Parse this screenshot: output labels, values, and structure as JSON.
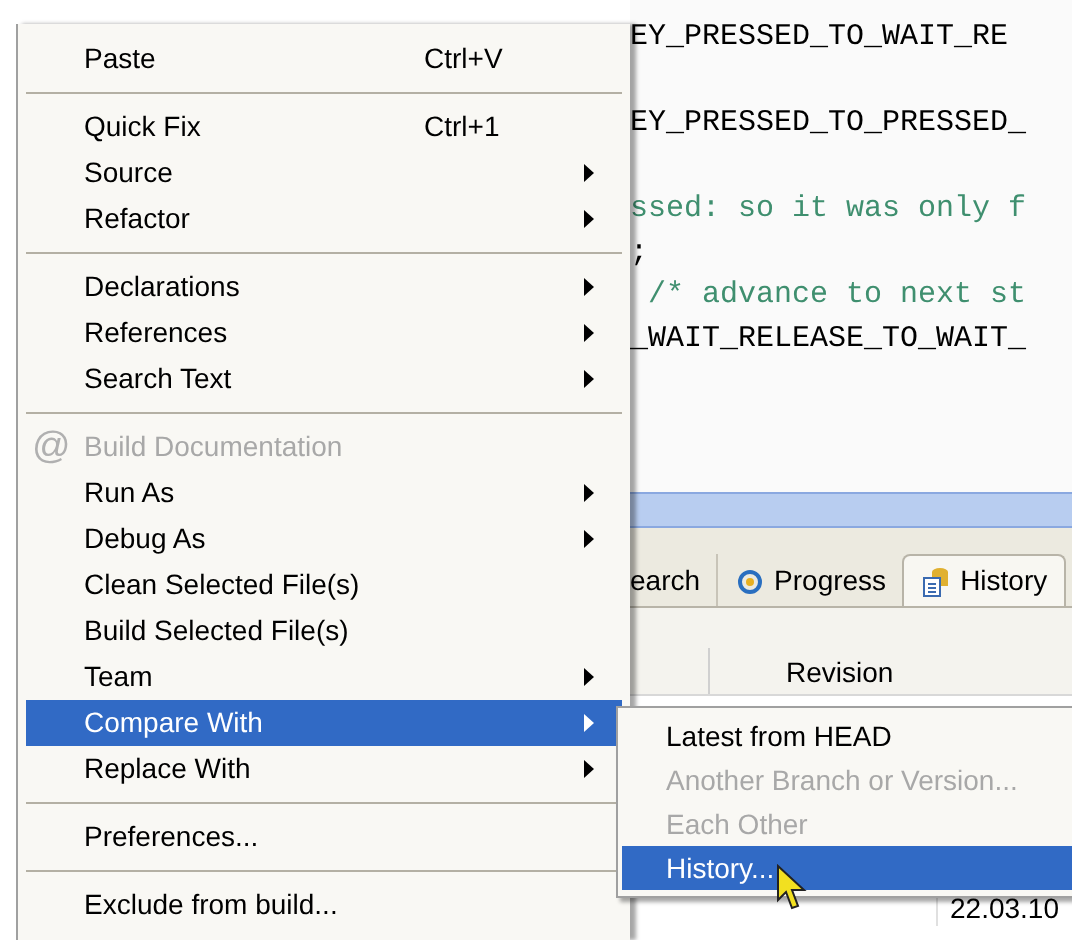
{
  "editor": {
    "lines": [
      {
        "text": "EY_PRESSED_TO_WAIT_RE",
        "kind": "code"
      },
      {
        "kind": "blank"
      },
      {
        "text": "EY_PRESSED_TO_PRESSED_",
        "kind": "code"
      },
      {
        "kind": "blank"
      },
      {
        "text": "ssed: so it was only f",
        "kind": "comment"
      },
      {
        "text": ";",
        "kind": "code"
      },
      {
        "text": " /* advance to next st",
        "kind": "comment"
      },
      {
        "text": "_WAIT_RELEASE_TO_WAIT_",
        "kind": "code"
      }
    ]
  },
  "view_tabs": [
    {
      "label": "earch",
      "selected": false,
      "has_icon": false
    },
    {
      "label": "Progress",
      "selected": false,
      "has_icon": true
    },
    {
      "label": "History",
      "selected": true,
      "has_icon": true
    }
  ],
  "table": {
    "columns": [
      "Revision"
    ],
    "rows": [
      [
        "22.03.10"
      ]
    ]
  },
  "context_menu": [
    {
      "kind": "item",
      "label": "Paste",
      "shortcut": "Ctrl+V",
      "submenu": false,
      "disabled": false,
      "selected": false
    },
    {
      "kind": "separator"
    },
    {
      "kind": "item",
      "label": "Quick Fix",
      "shortcut": "Ctrl+1",
      "submenu": false,
      "disabled": false,
      "selected": false
    },
    {
      "kind": "item",
      "label": "Source",
      "submenu": true,
      "disabled": false,
      "selected": false
    },
    {
      "kind": "item",
      "label": "Refactor",
      "submenu": true,
      "disabled": false,
      "selected": false
    },
    {
      "kind": "separator"
    },
    {
      "kind": "item",
      "label": "Declarations",
      "submenu": true,
      "disabled": false,
      "selected": false
    },
    {
      "kind": "item",
      "label": "References",
      "submenu": true,
      "disabled": false,
      "selected": false
    },
    {
      "kind": "item",
      "label": "Search Text",
      "submenu": true,
      "disabled": false,
      "selected": false
    },
    {
      "kind": "separator"
    },
    {
      "kind": "item",
      "label": "Build Documentation",
      "icon": "@",
      "submenu": false,
      "disabled": true,
      "selected": false
    },
    {
      "kind": "item",
      "label": "Run As",
      "submenu": true,
      "disabled": false,
      "selected": false
    },
    {
      "kind": "item",
      "label": "Debug As",
      "submenu": true,
      "disabled": false,
      "selected": false
    },
    {
      "kind": "item",
      "label": "Clean Selected File(s)",
      "submenu": false,
      "disabled": false,
      "selected": false
    },
    {
      "kind": "item",
      "label": "Build Selected File(s)",
      "submenu": false,
      "disabled": false,
      "selected": false
    },
    {
      "kind": "item",
      "label": "Team",
      "submenu": true,
      "disabled": false,
      "selected": false
    },
    {
      "kind": "item",
      "label": "Compare With",
      "submenu": true,
      "disabled": false,
      "selected": true
    },
    {
      "kind": "item",
      "label": "Replace With",
      "submenu": true,
      "disabled": false,
      "selected": false
    },
    {
      "kind": "separator"
    },
    {
      "kind": "item",
      "label": "Preferences...",
      "submenu": false,
      "disabled": false,
      "selected": false
    },
    {
      "kind": "separator"
    },
    {
      "kind": "item",
      "label": "Exclude from build...",
      "submenu": false,
      "disabled": false,
      "selected": false
    }
  ],
  "submenu": [
    {
      "label": "Latest from HEAD",
      "disabled": false,
      "selected": false
    },
    {
      "label": "Another Branch or Version...",
      "disabled": true,
      "selected": false
    },
    {
      "label": "Each Other",
      "disabled": true,
      "selected": false
    },
    {
      "label": "History...",
      "disabled": false,
      "selected": true
    }
  ]
}
